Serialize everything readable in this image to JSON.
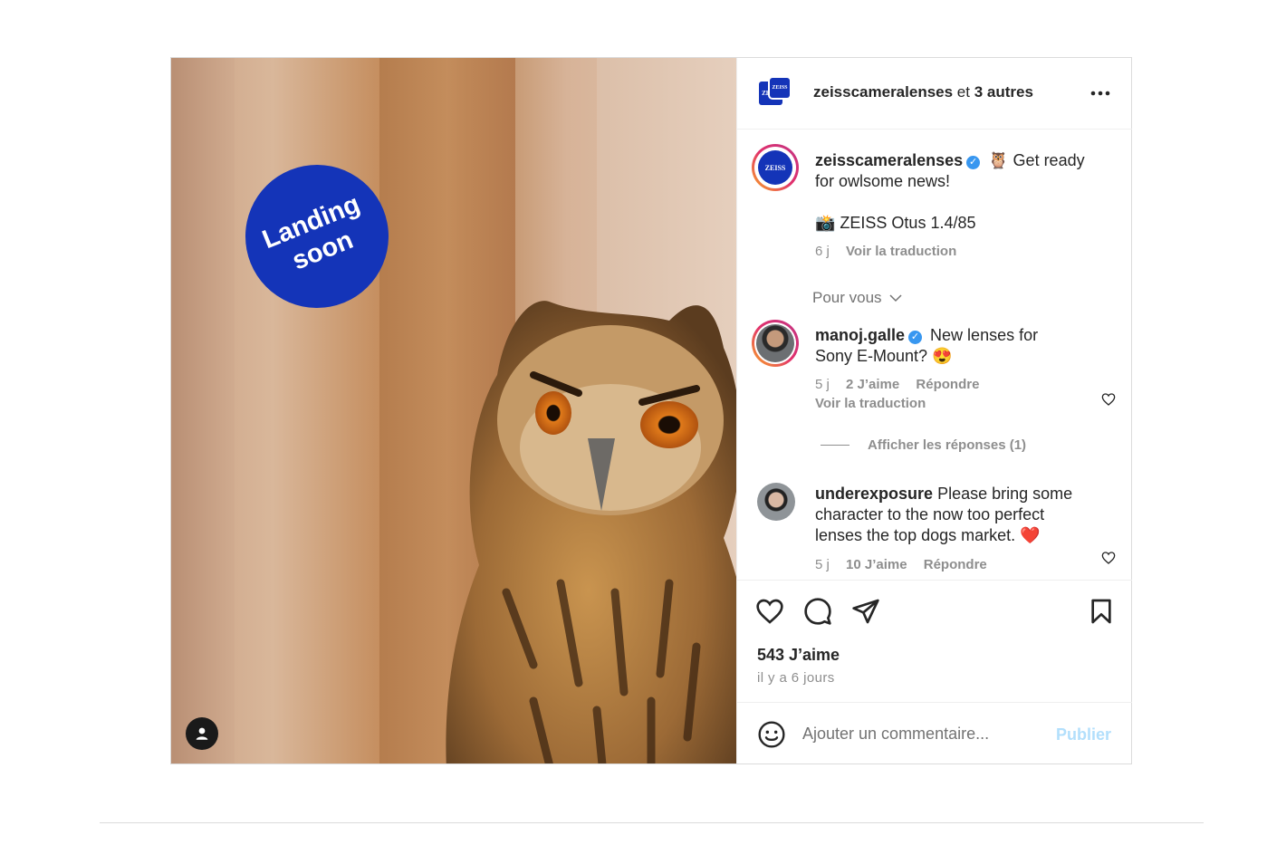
{
  "post": {
    "header": {
      "account": "zeisscameralenses",
      "and_word": "et",
      "others": "3 autres",
      "logo_text": "ZEISS"
    },
    "media": {
      "badge_line1": "Landing",
      "badge_line2": "soon"
    },
    "caption": {
      "username": "zeisscameralenses",
      "text_line1": "🦉 Get ready",
      "text_line2": "for owlsome news!",
      "text_line3": "📸 ZEISS Otus 1.4/85",
      "time": "6 j",
      "translate": "Voir la traduction"
    },
    "for_you": "Pour vous",
    "comments": [
      {
        "username": "manoj.galle",
        "text_line1": "New lenses for",
        "text_line2": "Sony E-Mount? 😍",
        "time": "5 j",
        "likes": "2 J’aime",
        "reply": "Répondre",
        "translate": "Voir la traduction",
        "view_replies": "Afficher les réponses (1)"
      },
      {
        "username": "underexposure",
        "text_line1": "Please bring some",
        "text_line2": "character to the now too perfect",
        "text_line3": "lenses the top dogs market. ❤️",
        "time": "5 j",
        "likes": "10 J’aime",
        "reply": "Répondre"
      }
    ],
    "likes_count": "543 J’aime",
    "posted_ago": "il y a 6 jours",
    "add_comment_placeholder": "Ajouter un commentaire...",
    "publish": "Publier"
  }
}
